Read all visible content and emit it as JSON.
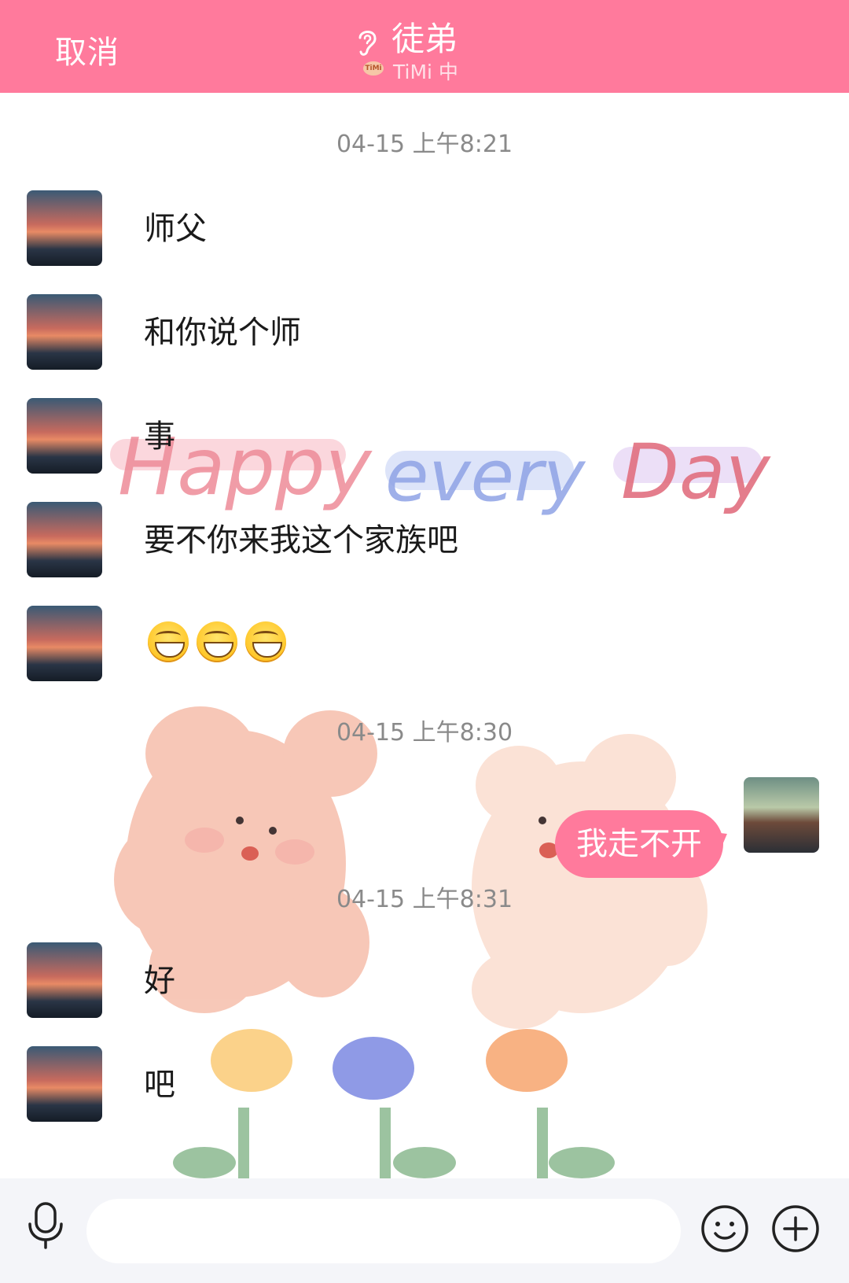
{
  "header": {
    "cancel_label": "取消",
    "title": "徒弟",
    "status": "TiMi 中",
    "status_icon": "timi-logo",
    "ear_icon": "ear-icon",
    "background_color": "#ff7a9c"
  },
  "chat": {
    "decoration_text": "Happy every Day",
    "timestamps": [
      "04-15 上午8:21",
      "04-15 上午8:30",
      "04-15 上午8:31"
    ],
    "messages": [
      {
        "sender": "friend",
        "text": "师父"
      },
      {
        "sender": "friend",
        "text": "和你说个师"
      },
      {
        "sender": "friend",
        "text": "事"
      },
      {
        "sender": "friend",
        "text": "要不你来我这个家族吧"
      },
      {
        "sender": "friend",
        "text": "😁😁😁",
        "type": "emoji",
        "emoji": "grinning-face",
        "count": 3
      },
      {
        "sender": "me",
        "text": "我走不开"
      },
      {
        "sender": "friend",
        "text": "好"
      },
      {
        "sender": "friend",
        "text": "吧"
      }
    ],
    "bubble_color": "#ff7a9c"
  },
  "input_bar": {
    "input_value": "",
    "icons": [
      "mic-icon",
      "smile-icon",
      "plus-icon"
    ]
  }
}
